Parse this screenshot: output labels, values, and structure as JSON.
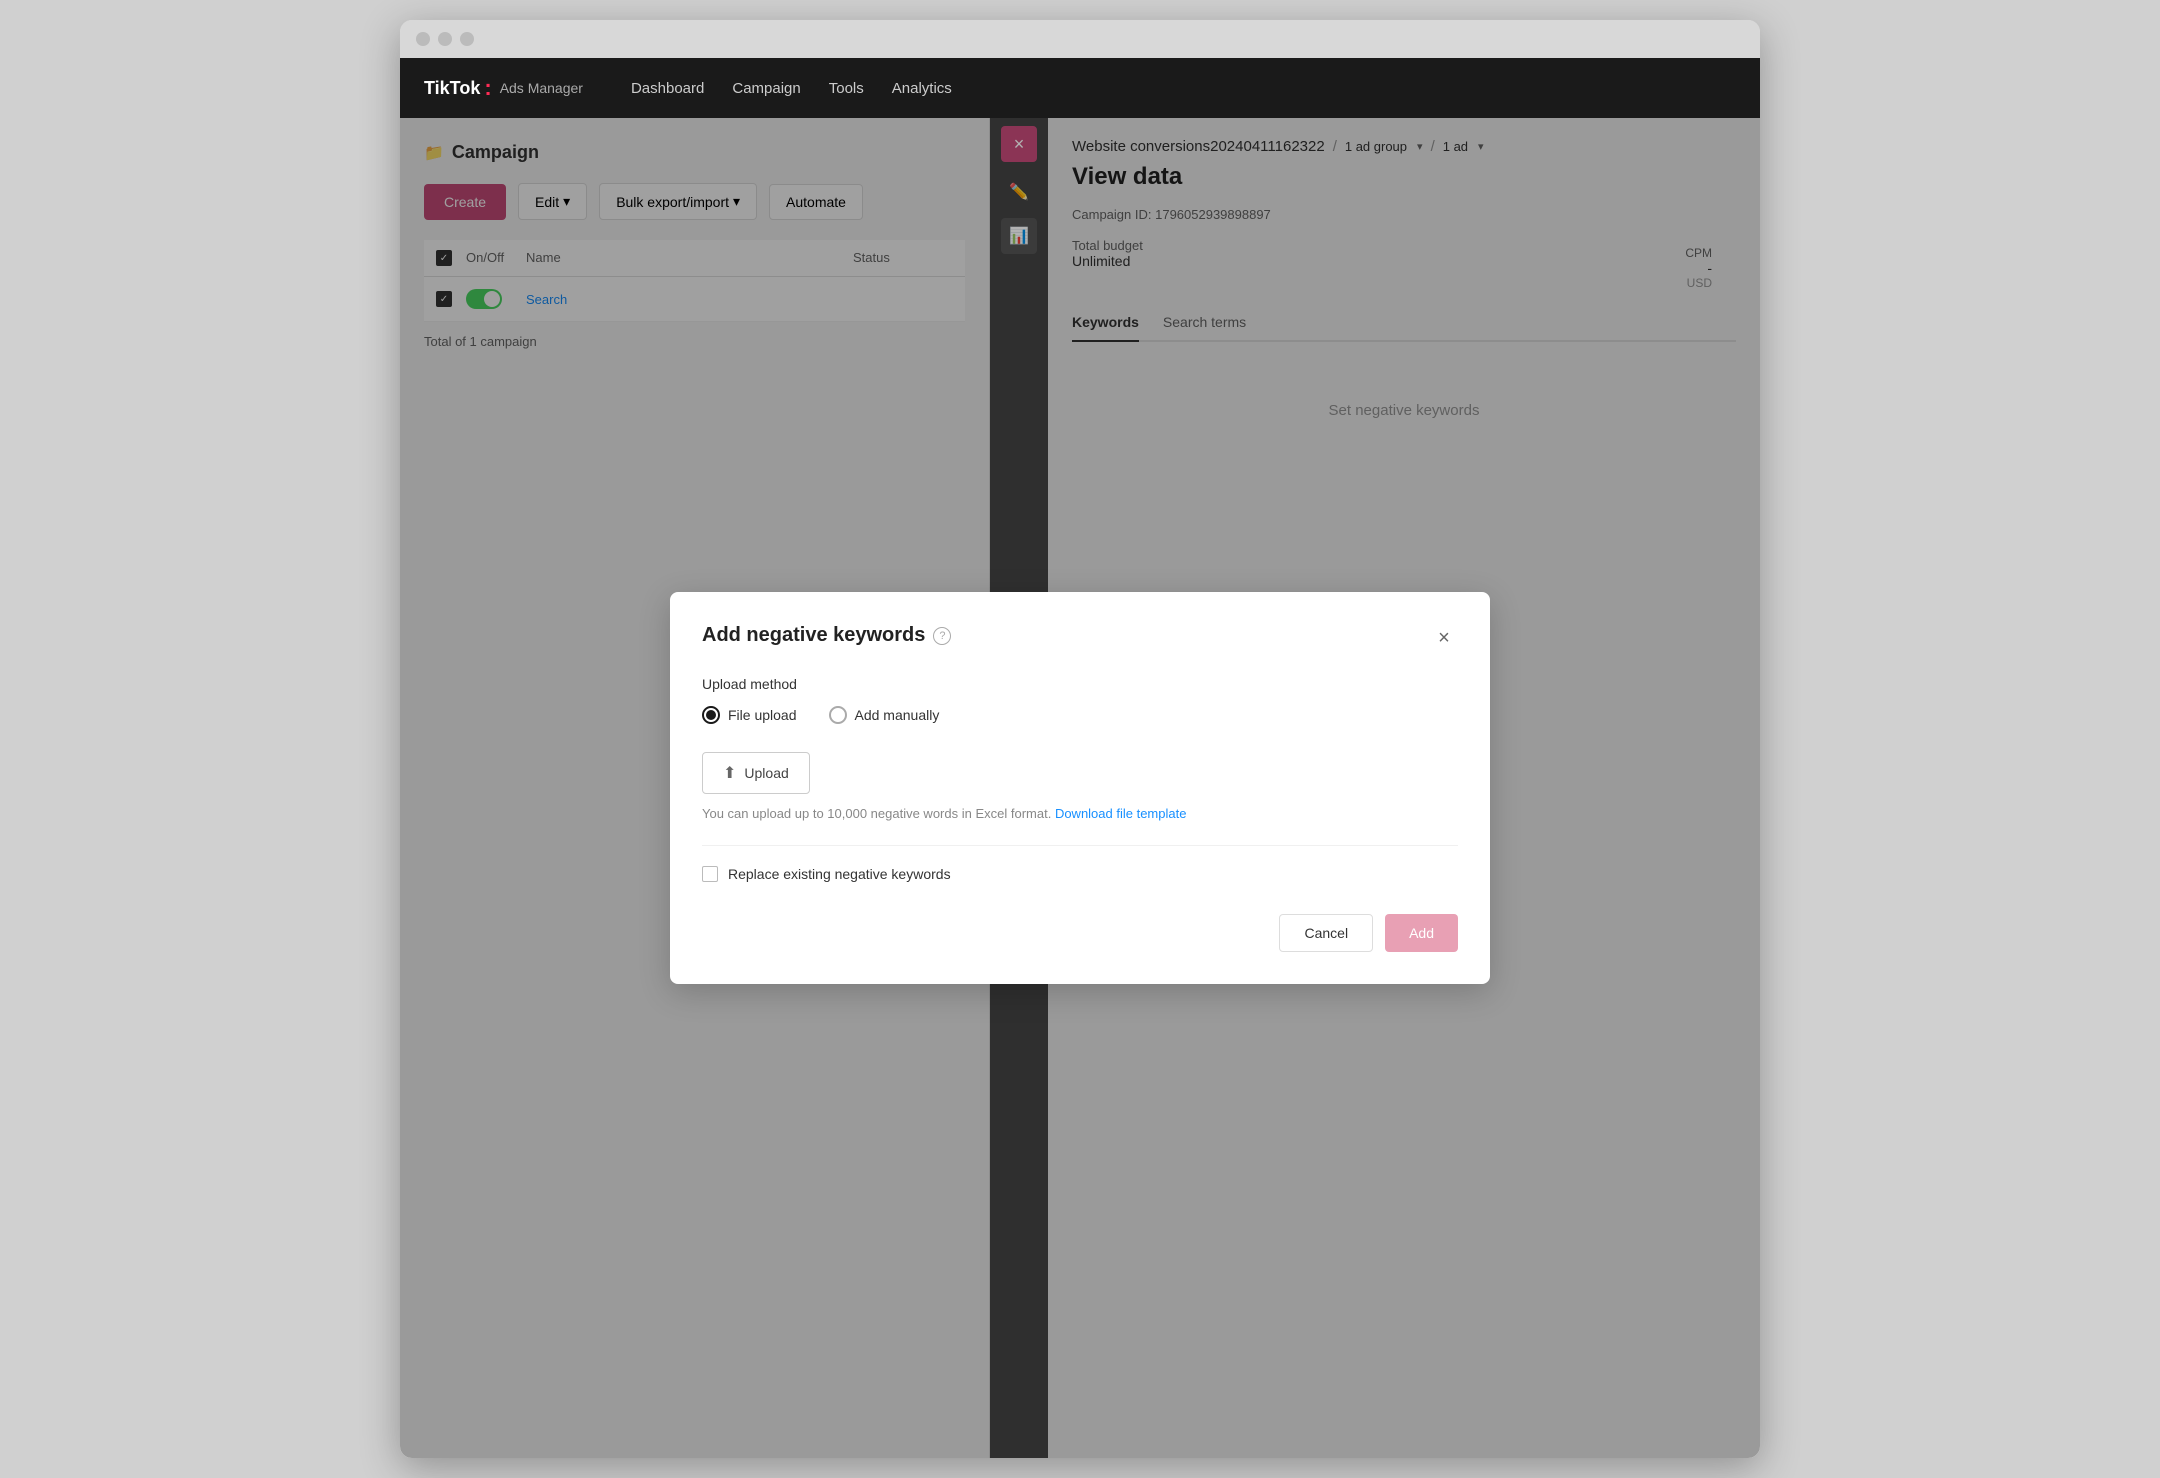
{
  "browser": {
    "dots": [
      "dot1",
      "dot2",
      "dot3"
    ]
  },
  "nav": {
    "logo_tiktok": "TikTok",
    "logo_colon": ":",
    "logo_ads": "Ads Manager",
    "links": [
      "Dashboard",
      "Campaign",
      "Tools",
      "Analytics"
    ]
  },
  "left_panel": {
    "title": "Campaign",
    "toolbar": {
      "create": "Create",
      "edit": "Edit",
      "edit_arrow": "▾",
      "bulk": "Bulk export/import",
      "bulk_arrow": "▾",
      "automate": "Automate"
    },
    "table": {
      "headers": [
        "",
        "On/Off",
        "Name",
        "Status"
      ],
      "rows": [
        {
          "checked": true,
          "toggled": true,
          "name": "Search",
          "name_suffix": "",
          "status": ""
        }
      ]
    },
    "total": "Total of 1 campaign"
  },
  "sidebar_strip": {
    "close_icon": "×",
    "edit_icon": "✏",
    "chart_icon": "📊"
  },
  "right_panel": {
    "breadcrumb_campaign": "Website conversions20240411162322",
    "breadcrumb_sep1": "/",
    "breadcrumb_adgroup": "1 ad group",
    "breadcrumb_dropdown1": "▾",
    "breadcrumb_sep2": "/",
    "breadcrumb_ad": "1 ad",
    "breadcrumb_dropdown2": "▾",
    "view_data_title": "View data",
    "campaign_id_label": "Campaign ID:",
    "campaign_id": "1796052939898897",
    "total_budget_label": "Total budget",
    "unlimited": "Unlimited",
    "tabs": [
      "Keywords",
      "Search terms"
    ],
    "set_keywords": "Set negative keywords",
    "cpm_label": "CPM",
    "cpm_dash": "-",
    "usd": "USD"
  },
  "modal": {
    "title": "Add negative keywords",
    "help_icon": "?",
    "close_icon": "×",
    "upload_method_label": "Upload method",
    "radio_options": [
      "File upload",
      "Add manually"
    ],
    "selected_option": 0,
    "upload_btn": "Upload",
    "upload_hint_prefix": "You can upload up to 10,000 negative words in Excel format.",
    "download_link": "Download file template",
    "replace_label": "Replace existing negative keywords",
    "cancel_btn": "Cancel",
    "add_btn": "Add"
  }
}
